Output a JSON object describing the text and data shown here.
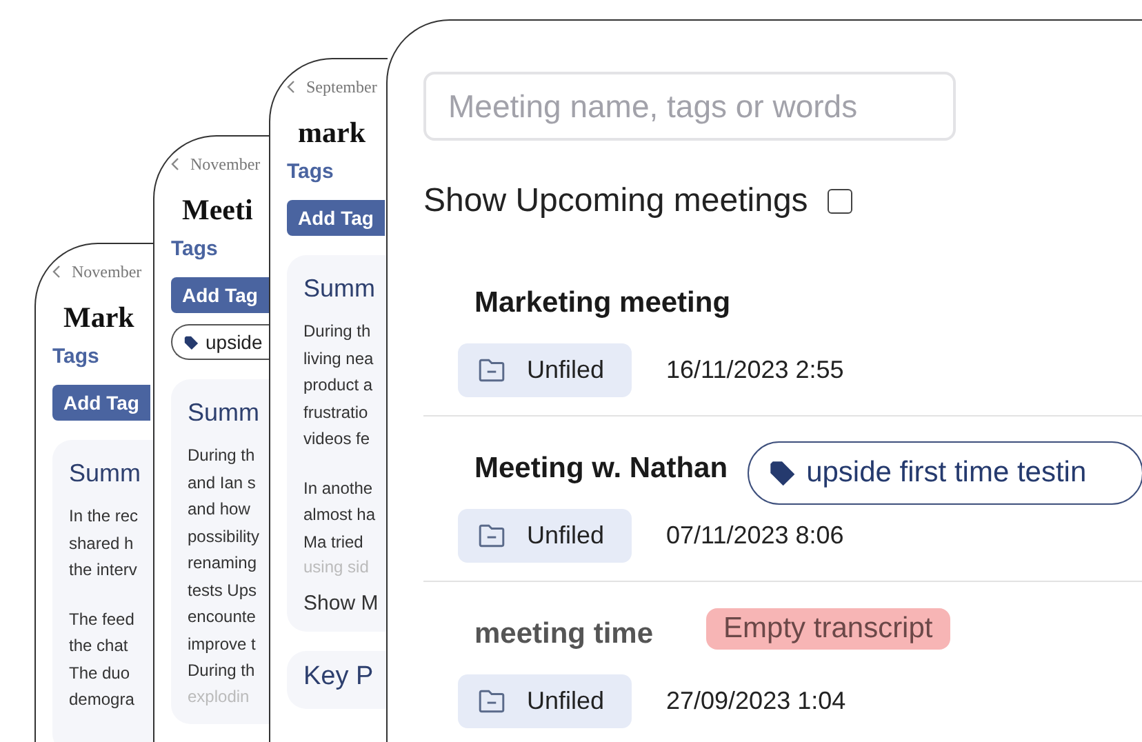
{
  "back_phones": [
    {
      "back_label": "November",
      "title": "Mark",
      "tags_label": "Tags",
      "add_tag": "Add Tag",
      "summary_heading": "Summ",
      "paragraphs": [
        [
          "In the rec",
          "shared h",
          "the interv"
        ],
        [
          "The feed",
          "the chat",
          "The duo",
          "demogra"
        ]
      ]
    },
    {
      "back_label": "November",
      "title": "Meeti",
      "tags_label": "Tags",
      "add_tag": "Add Tag",
      "tags": [
        "upside"
      ],
      "summary_heading": "Summ",
      "paragraphs": [
        [
          "During th",
          "and Ian s",
          "and how",
          "possibility",
          "renaming",
          "tests Ups",
          "encounte",
          "improve t",
          "During th"
        ]
      ],
      "faded_line": "explodin"
    },
    {
      "back_label": "September",
      "title": "mark",
      "tags_label": "Tags",
      "add_tag": "Add Tag",
      "summary_heading": "Summ",
      "paragraphs": [
        [
          "During th",
          "living nea",
          "product a",
          "frustratio",
          "videos fe"
        ],
        [
          "In anothe",
          "almost ha",
          "Ma tried"
        ]
      ],
      "faded_line": "using sid",
      "show_more": "Show M",
      "next_heading": "Key P"
    }
  ],
  "front_phone": {
    "search": {
      "placeholder": "Meeting name, tags or words"
    },
    "upcoming": {
      "label": "Show Upcoming meetings",
      "checked": false
    },
    "meetings": [
      {
        "title": "Marketing meeting",
        "muted": false,
        "folder": "Unfiled",
        "date": "16/11/2023 2:55"
      },
      {
        "title": "Meeting w. Nathan",
        "muted": false,
        "tags": [
          "upside first time testin"
        ],
        "folder": "Unfiled",
        "date": "07/11/2023 8:06"
      },
      {
        "title": "meeting time",
        "muted": true,
        "badge": "Empty transcript",
        "folder": "Unfiled",
        "date": "27/09/2023 1:04"
      }
    ]
  }
}
